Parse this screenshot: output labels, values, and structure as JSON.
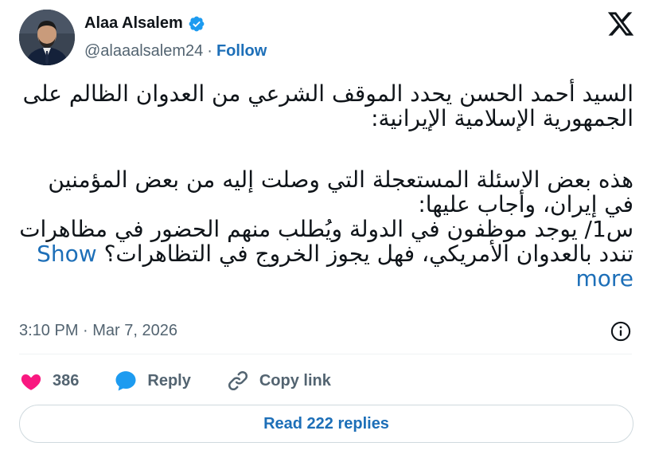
{
  "author": {
    "display_name": "Alaa Alsalem",
    "handle": "@alaaalsalem24",
    "separator": "·",
    "follow_label": "Follow",
    "verified": true
  },
  "tweet": {
    "paragraph1": "السيد أحمد الحسن يحدد الموقف الشرعي من العدوان الظالم على الجمهورية الإسلامية الإيرانية:",
    "paragraph2_a": "هذه بعض الاسئلة المستعجلة التي وصلت إليه من بعض المؤمنين في إيران، وأجاب عليها:",
    "paragraph2_b": "س1/ يوجد موظفون في الدولة ويُطلب منهم الحضور في مظاهرات تندد بالعدوان الأمريكي، فهل يجوز الخروج في التظاهرات؟",
    "show_more_label": "Show more"
  },
  "meta": {
    "timestamp": "3:10 PM · Mar 7, 2026"
  },
  "actions": {
    "likes_count": "386",
    "reply_label": "Reply",
    "copy_link_label": "Copy link"
  },
  "footer": {
    "read_replies_label": "Read 222 replies"
  },
  "colors": {
    "accent": "#1d6fb8",
    "heart": "#f91880",
    "muted": "#536471",
    "verified_badge": "#1d9bf0"
  }
}
